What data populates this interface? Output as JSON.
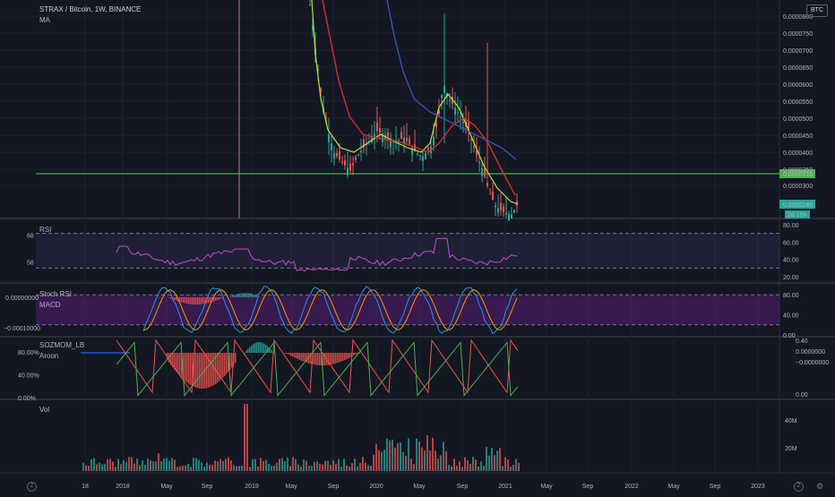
{
  "header": {
    "symbol": "STRAX / Bitcoin, 1W, BINANCE",
    "indicator": "MA",
    "currency_badge": "BTC"
  },
  "main_axis": {
    "ticks": [
      "0.0000800",
      "0.0000750",
      "0.0000700",
      "0.0000650",
      "0.0000600",
      "0.0000550",
      "0.0000500",
      "0.0000450",
      "0.0000400",
      "0.0000350",
      "0.0000300"
    ],
    "price_tags": [
      {
        "text": "0.0000316",
        "color": "#4caf50"
      },
      {
        "text": "0.0000240",
        "color": "#26a69a"
      },
      {
        "text": "2d 15h",
        "color": "#26a69a"
      }
    ]
  },
  "rsi": {
    "label": "RSI",
    "axis": [
      "80.00",
      "60.00",
      "40.00",
      "20.00"
    ],
    "left_values": [
      "68",
      "58"
    ]
  },
  "stoch": {
    "label": "Stoch RSI",
    "axis": [
      "80.00",
      "40.00",
      "0.00"
    ]
  },
  "macd": {
    "label": "MACD",
    "left_values": [
      "0.00000000",
      "−0.00010000"
    ]
  },
  "soz": {
    "label": "SOZMOM_LB",
    "axis": [
      "0.40",
      "0.0000000",
      "−0.0000000",
      "0.00"
    ],
    "axis2": [
      "0.0000000",
      "−0.0020000",
      "−0.0040000"
    ]
  },
  "aroon": {
    "label": "Aroon",
    "left_values": [
      "80.00%",
      "40.00%",
      "0.00%"
    ]
  },
  "vol": {
    "label": "Vol",
    "axis": [
      "40M",
      "20M"
    ]
  },
  "time_axis": [
    "18",
    "2018",
    "May",
    "Sep",
    "2019",
    "May",
    "Sep",
    "2020",
    "May",
    "Sep",
    "2021",
    "May",
    "Sep",
    "2022",
    "May",
    "Sep",
    "2023"
  ],
  "footer": {
    "left_icon_text": "Z",
    "right_icon_text": "Z"
  },
  "colors": {
    "background": "#131722",
    "up": "#26a69a",
    "down": "#ef5350",
    "ma_fast": "#cddc39",
    "ma_mid": "#d32f2f",
    "ma_slow": "#3f51b5",
    "hline": "#4caf50",
    "rsi": "#ab47bc",
    "stoch_k": "#2196f3",
    "stoch_d": "#ff9800"
  },
  "chart_data": {
    "type": "candlestick",
    "title": "STRAX / Bitcoin, 1W, BINANCE",
    "x_range": [
      "2017-10",
      "2023-03"
    ],
    "ylim": [
      3e-05,
      8e-05
    ],
    "series": [
      {
        "name": "MA",
        "approx": "moving averages overlay"
      }
    ]
  }
}
